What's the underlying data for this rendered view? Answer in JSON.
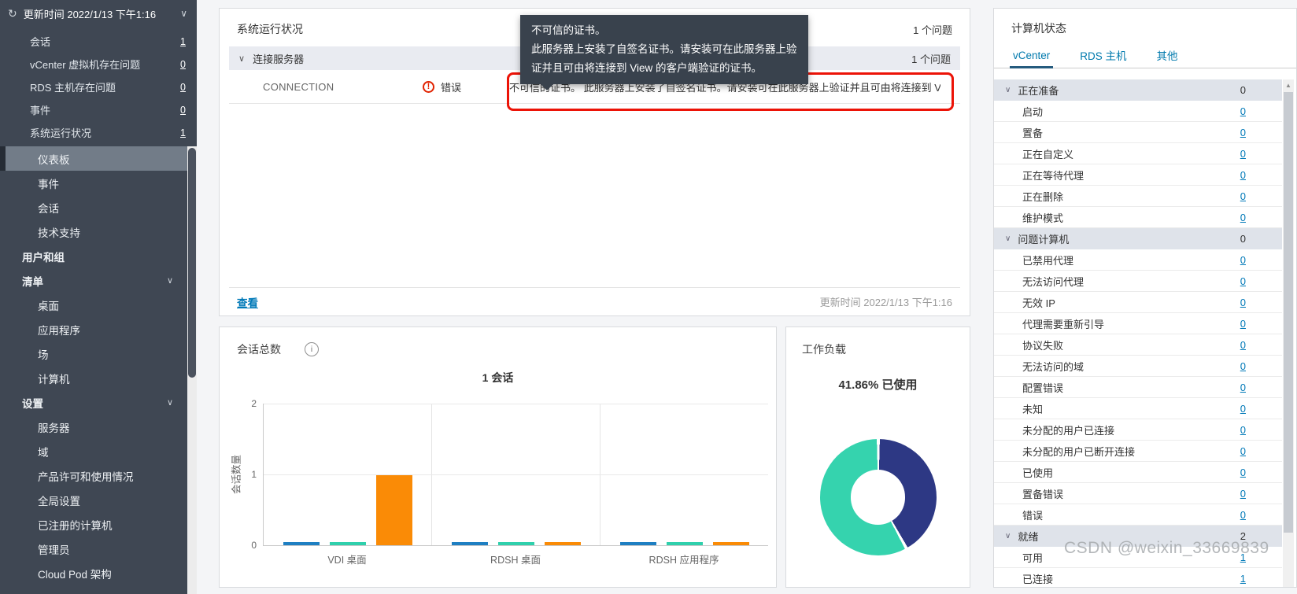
{
  "sidebar": {
    "header": {
      "label": "更新时间 2022/1/13 下午1:16"
    },
    "alerts": [
      {
        "id": "sessions",
        "label": "会话",
        "value": "1"
      },
      {
        "id": "vcenter-vm-issues",
        "label": "vCenter 虚拟机存在问题",
        "value": "0"
      },
      {
        "id": "rds-host-issues",
        "label": "RDS 主机存在问题",
        "value": "0"
      },
      {
        "id": "events",
        "label": "事件",
        "value": "0"
      },
      {
        "id": "system-health",
        "label": "系统运行状况",
        "value": "1"
      }
    ],
    "nav": [
      {
        "id": "dashboard",
        "label": "仪表板",
        "level": 1,
        "active": true
      },
      {
        "id": "events",
        "label": "事件",
        "level": 1
      },
      {
        "id": "sessions",
        "label": "会话",
        "level": 1
      },
      {
        "id": "help-desk",
        "label": "技术支持",
        "level": 1
      },
      {
        "id": "users-and-groups",
        "label": "用户和组",
        "level": 0
      },
      {
        "id": "inventory",
        "label": "清单",
        "level": 0,
        "expandable": true
      },
      {
        "id": "desktops",
        "label": "桌面",
        "level": 1
      },
      {
        "id": "applications",
        "label": "应用程序",
        "level": 1
      },
      {
        "id": "farms",
        "label": "场",
        "level": 1
      },
      {
        "id": "machines",
        "label": "计算机",
        "level": 1
      },
      {
        "id": "settings",
        "label": "设置",
        "level": 0,
        "expandable": true
      },
      {
        "id": "servers",
        "label": "服务器",
        "level": 1
      },
      {
        "id": "domains",
        "label": "域",
        "level": 1
      },
      {
        "id": "licensing-usage",
        "label": "产品许可和使用情况",
        "level": 1
      },
      {
        "id": "global-settings",
        "label": "全局设置",
        "level": 1
      },
      {
        "id": "registered-machines",
        "label": "已注册的计算机",
        "level": 1
      },
      {
        "id": "administrators",
        "label": "管理员",
        "level": 1
      },
      {
        "id": "cloud-pod",
        "label": "Cloud Pod 架构",
        "level": 1
      }
    ]
  },
  "health_card": {
    "title": "系统运行状况",
    "issues": "1 个问题",
    "section": {
      "label": "连接服务器",
      "issues": "1 个问题"
    },
    "row": {
      "name": "CONNECTION",
      "status": "错误",
      "message": "不可信的证书。 此服务器上安装了自签名证书。请安装可在此服务器上验证并且可由将连接到 View ..."
    },
    "view_link": "查看",
    "updated": "更新时间 2022/1/13 下午1:16"
  },
  "tooltip": {
    "lines": [
      "不可信的证书。",
      "此服务器上安装了自签名证书。请安装可在此服务器上验",
      "证并且可由将连接到 View 的客户端验证的证书。"
    ]
  },
  "sessions_card": {
    "title": "会话总数"
  },
  "workload_card": {
    "title": "工作负载",
    "subtitle": "41.86% 已使用"
  },
  "chart_data": [
    {
      "type": "bar",
      "title": "1 会话",
      "categories": [
        "VDI 桌面",
        "RDSH 桌面",
        "RDSH 应用程序"
      ],
      "series": [
        {
          "name": "bar-blue",
          "color": "#1e7fc2",
          "values": [
            0,
            0,
            0
          ]
        },
        {
          "name": "bar-teal",
          "color": "#2fd0ac",
          "values": [
            0,
            0,
            0
          ]
        },
        {
          "name": "bar-orange",
          "color": "#fa8b06",
          "values": [
            1,
            0,
            0
          ]
        }
      ],
      "xlabel": "",
      "ylabel": "会话数量",
      "ylim": [
        0,
        2
      ],
      "yticks": [
        0,
        1,
        2
      ],
      "grid": true,
      "legend": false
    },
    {
      "type": "pie",
      "title": "工作负载",
      "label": "41.86% 已使用",
      "slices": [
        {
          "name": "已使用",
          "value": 41.86,
          "color": "#2d3884"
        },
        {
          "name": "可用",
          "value": 58.14,
          "color": "#35d3ae"
        }
      ],
      "donut": true
    }
  ],
  "machine_panel": {
    "title": "计算机状态",
    "tabs": [
      {
        "id": "vcenter",
        "label": "vCenter",
        "active": true
      },
      {
        "id": "rds-host",
        "label": "RDS 主机"
      },
      {
        "id": "others",
        "label": "其他"
      }
    ],
    "rows": [
      {
        "label": "正在准备",
        "value": "0",
        "group": true
      },
      {
        "label": "启动",
        "value": "0"
      },
      {
        "label": "置备",
        "value": "0"
      },
      {
        "label": "正在自定义",
        "value": "0"
      },
      {
        "label": "正在等待代理",
        "value": "0"
      },
      {
        "label": "正在删除",
        "value": "0"
      },
      {
        "label": "维护模式",
        "value": "0"
      },
      {
        "label": "问题计算机",
        "value": "0",
        "group": true
      },
      {
        "label": "已禁用代理",
        "value": "0"
      },
      {
        "label": "无法访问代理",
        "value": "0"
      },
      {
        "label": "无效 IP",
        "value": "0"
      },
      {
        "label": "代理需要重新引导",
        "value": "0"
      },
      {
        "label": "协议失败",
        "value": "0"
      },
      {
        "label": "无法访问的域",
        "value": "0"
      },
      {
        "label": "配置错误",
        "value": "0"
      },
      {
        "label": "未知",
        "value": "0"
      },
      {
        "label": "未分配的用户已连接",
        "value": "0"
      },
      {
        "label": "未分配的用户已断开连接",
        "value": "0"
      },
      {
        "label": "已使用",
        "value": "0"
      },
      {
        "label": "置备错误",
        "value": "0"
      },
      {
        "label": "错误",
        "value": "0"
      },
      {
        "label": "就绪",
        "value": "2",
        "group": true
      },
      {
        "label": "可用",
        "value": "1"
      },
      {
        "label": "已连接",
        "value": "1"
      }
    ]
  },
  "watermark": "CSDN @weixin_33669839",
  "icons": {
    "refresh": "↻",
    "chevron_down": "∨",
    "chevron_up_small": "▲",
    "error": "!",
    "info": "i",
    "ellipsis": "..."
  },
  "colors": {
    "sidebar_bg": "#3f4753",
    "accent_link": "#0079b8",
    "error_red": "#e12200",
    "annotation_red": "#ec1307",
    "tooltip_bg": "#39424d",
    "group_row_bg": "#dfe3ea",
    "section_bar_bg": "#e9ebf1",
    "tab_underline": "#255b7e"
  }
}
